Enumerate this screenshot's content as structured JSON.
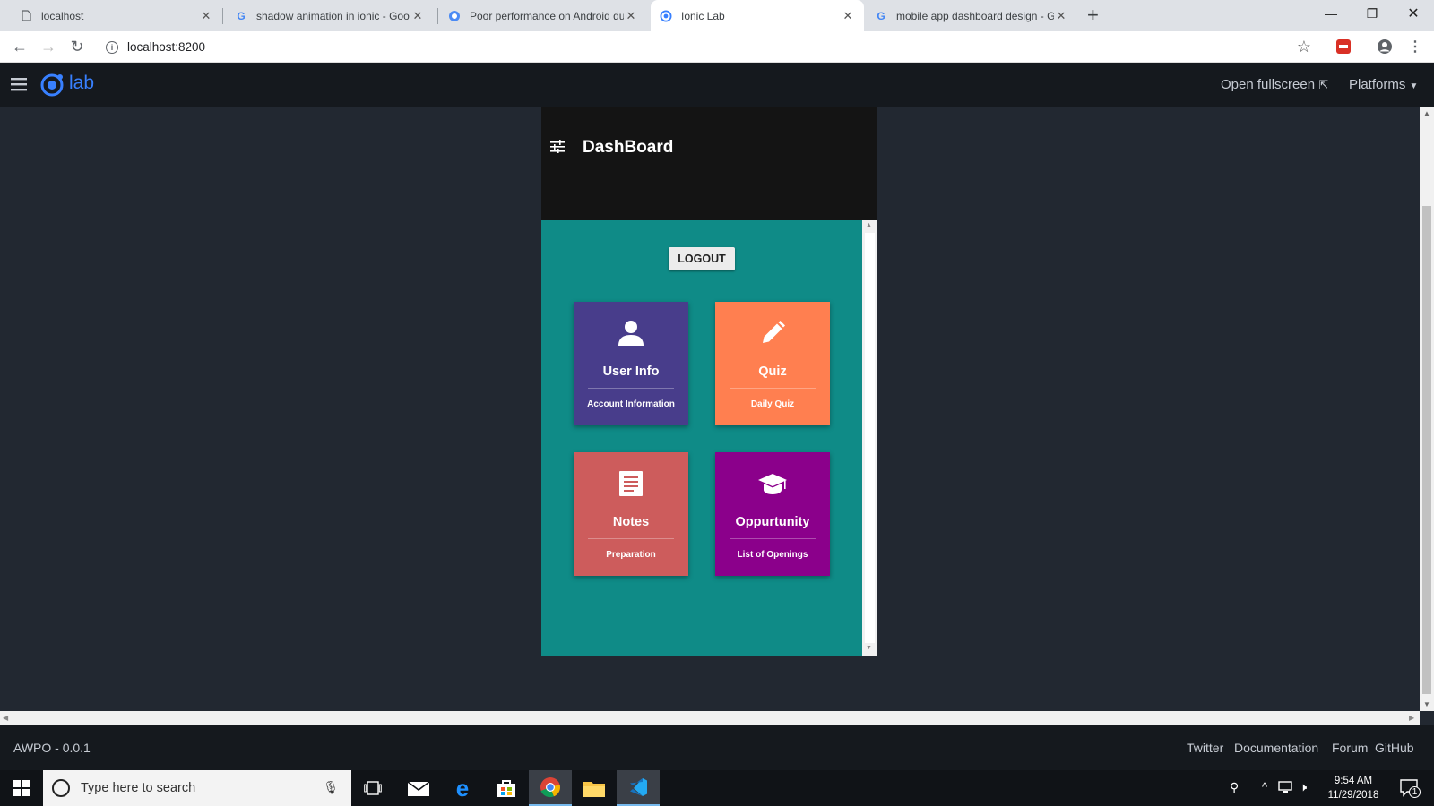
{
  "browser": {
    "tabs": [
      {
        "title": "localhost",
        "icon": "page-icon"
      },
      {
        "title": "shadow animation in ionic - Goo",
        "icon": "google-icon"
      },
      {
        "title": "Poor performance on Android du",
        "icon": "ionic-forum-icon"
      },
      {
        "title": "Ionic Lab",
        "icon": "ionic-icon"
      },
      {
        "title": "mobile app dashboard design - G",
        "icon": "google-icon"
      }
    ],
    "active_tab": 3,
    "url": "localhost:8200"
  },
  "lab": {
    "logo_text": "lab",
    "open_fullscreen": "Open fullscreen",
    "platforms": "Platforms",
    "version": "AWPO - 0.0.1",
    "footer_links": [
      "Twitter",
      "Documentation",
      "Forum",
      "GitHub"
    ]
  },
  "app": {
    "title": "DashBoard",
    "logout_label": "LOGOUT",
    "cards": [
      {
        "title": "User Info",
        "subtitle": "Account Information",
        "icon": "person-icon",
        "color": "#483d8b"
      },
      {
        "title": "Quiz",
        "subtitle": "Daily Quiz",
        "icon": "pencil-icon",
        "color": "#ff7f50"
      },
      {
        "title": "Notes",
        "subtitle": "Preparation",
        "icon": "notes-icon",
        "color": "#cd5c5c"
      },
      {
        "title": "Oppurtunity",
        "subtitle": "List of Openings",
        "icon": "graduation-cap-icon",
        "color": "#8b008b"
      }
    ]
  },
  "taskbar": {
    "search_placeholder": "Type here to search",
    "time": "9:54 AM",
    "date": "11/29/2018",
    "notification_count": "1"
  },
  "colors": {
    "app_background": "#0f8b87",
    "lab_blue": "#3880ff",
    "header_dark": "#141414"
  }
}
